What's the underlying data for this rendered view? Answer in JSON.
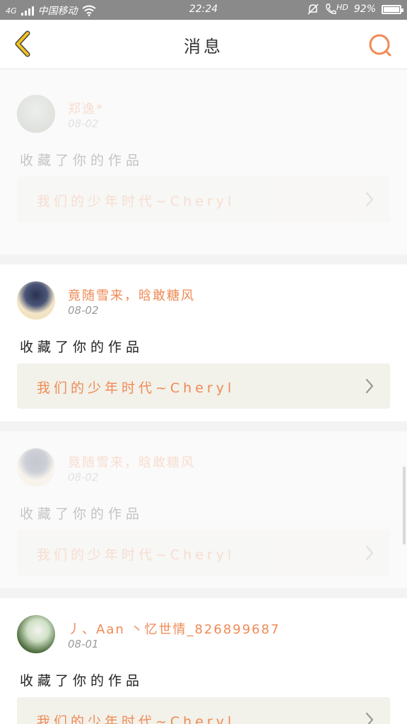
{
  "status_bar": {
    "network": "4G",
    "carrier": "中国移动",
    "time": "22:24",
    "hd_label": "HD",
    "battery": "92%"
  },
  "header": {
    "title": "消息"
  },
  "colors": {
    "accent": "#ef8a55",
    "back_icon": "#f2c21b",
    "work_bg": "#f2f1ea"
  },
  "messages": [
    {
      "username": "郑逸*",
      "date": "08-02",
      "action": "收藏了你的作品",
      "work_title": "我们的少年时代~Cheryl",
      "faded": true
    },
    {
      "username": "竟随雪来，晗敢糖风",
      "date": "08-02",
      "action": "收藏了你的作品",
      "work_title": "我们的少年时代~Cheryl",
      "faded": false
    },
    {
      "username": "竟随雪来，晗敢糖风",
      "date": "08-02",
      "action": "收藏了你的作品",
      "work_title": "我们的少年时代~Cheryl",
      "faded": true
    },
    {
      "username": "丿、Aan 丶忆世情_826899687",
      "date": "08-01",
      "action": "收藏了你的作品",
      "work_title": "我们的少年时代~Cheryl",
      "faded": false
    }
  ]
}
